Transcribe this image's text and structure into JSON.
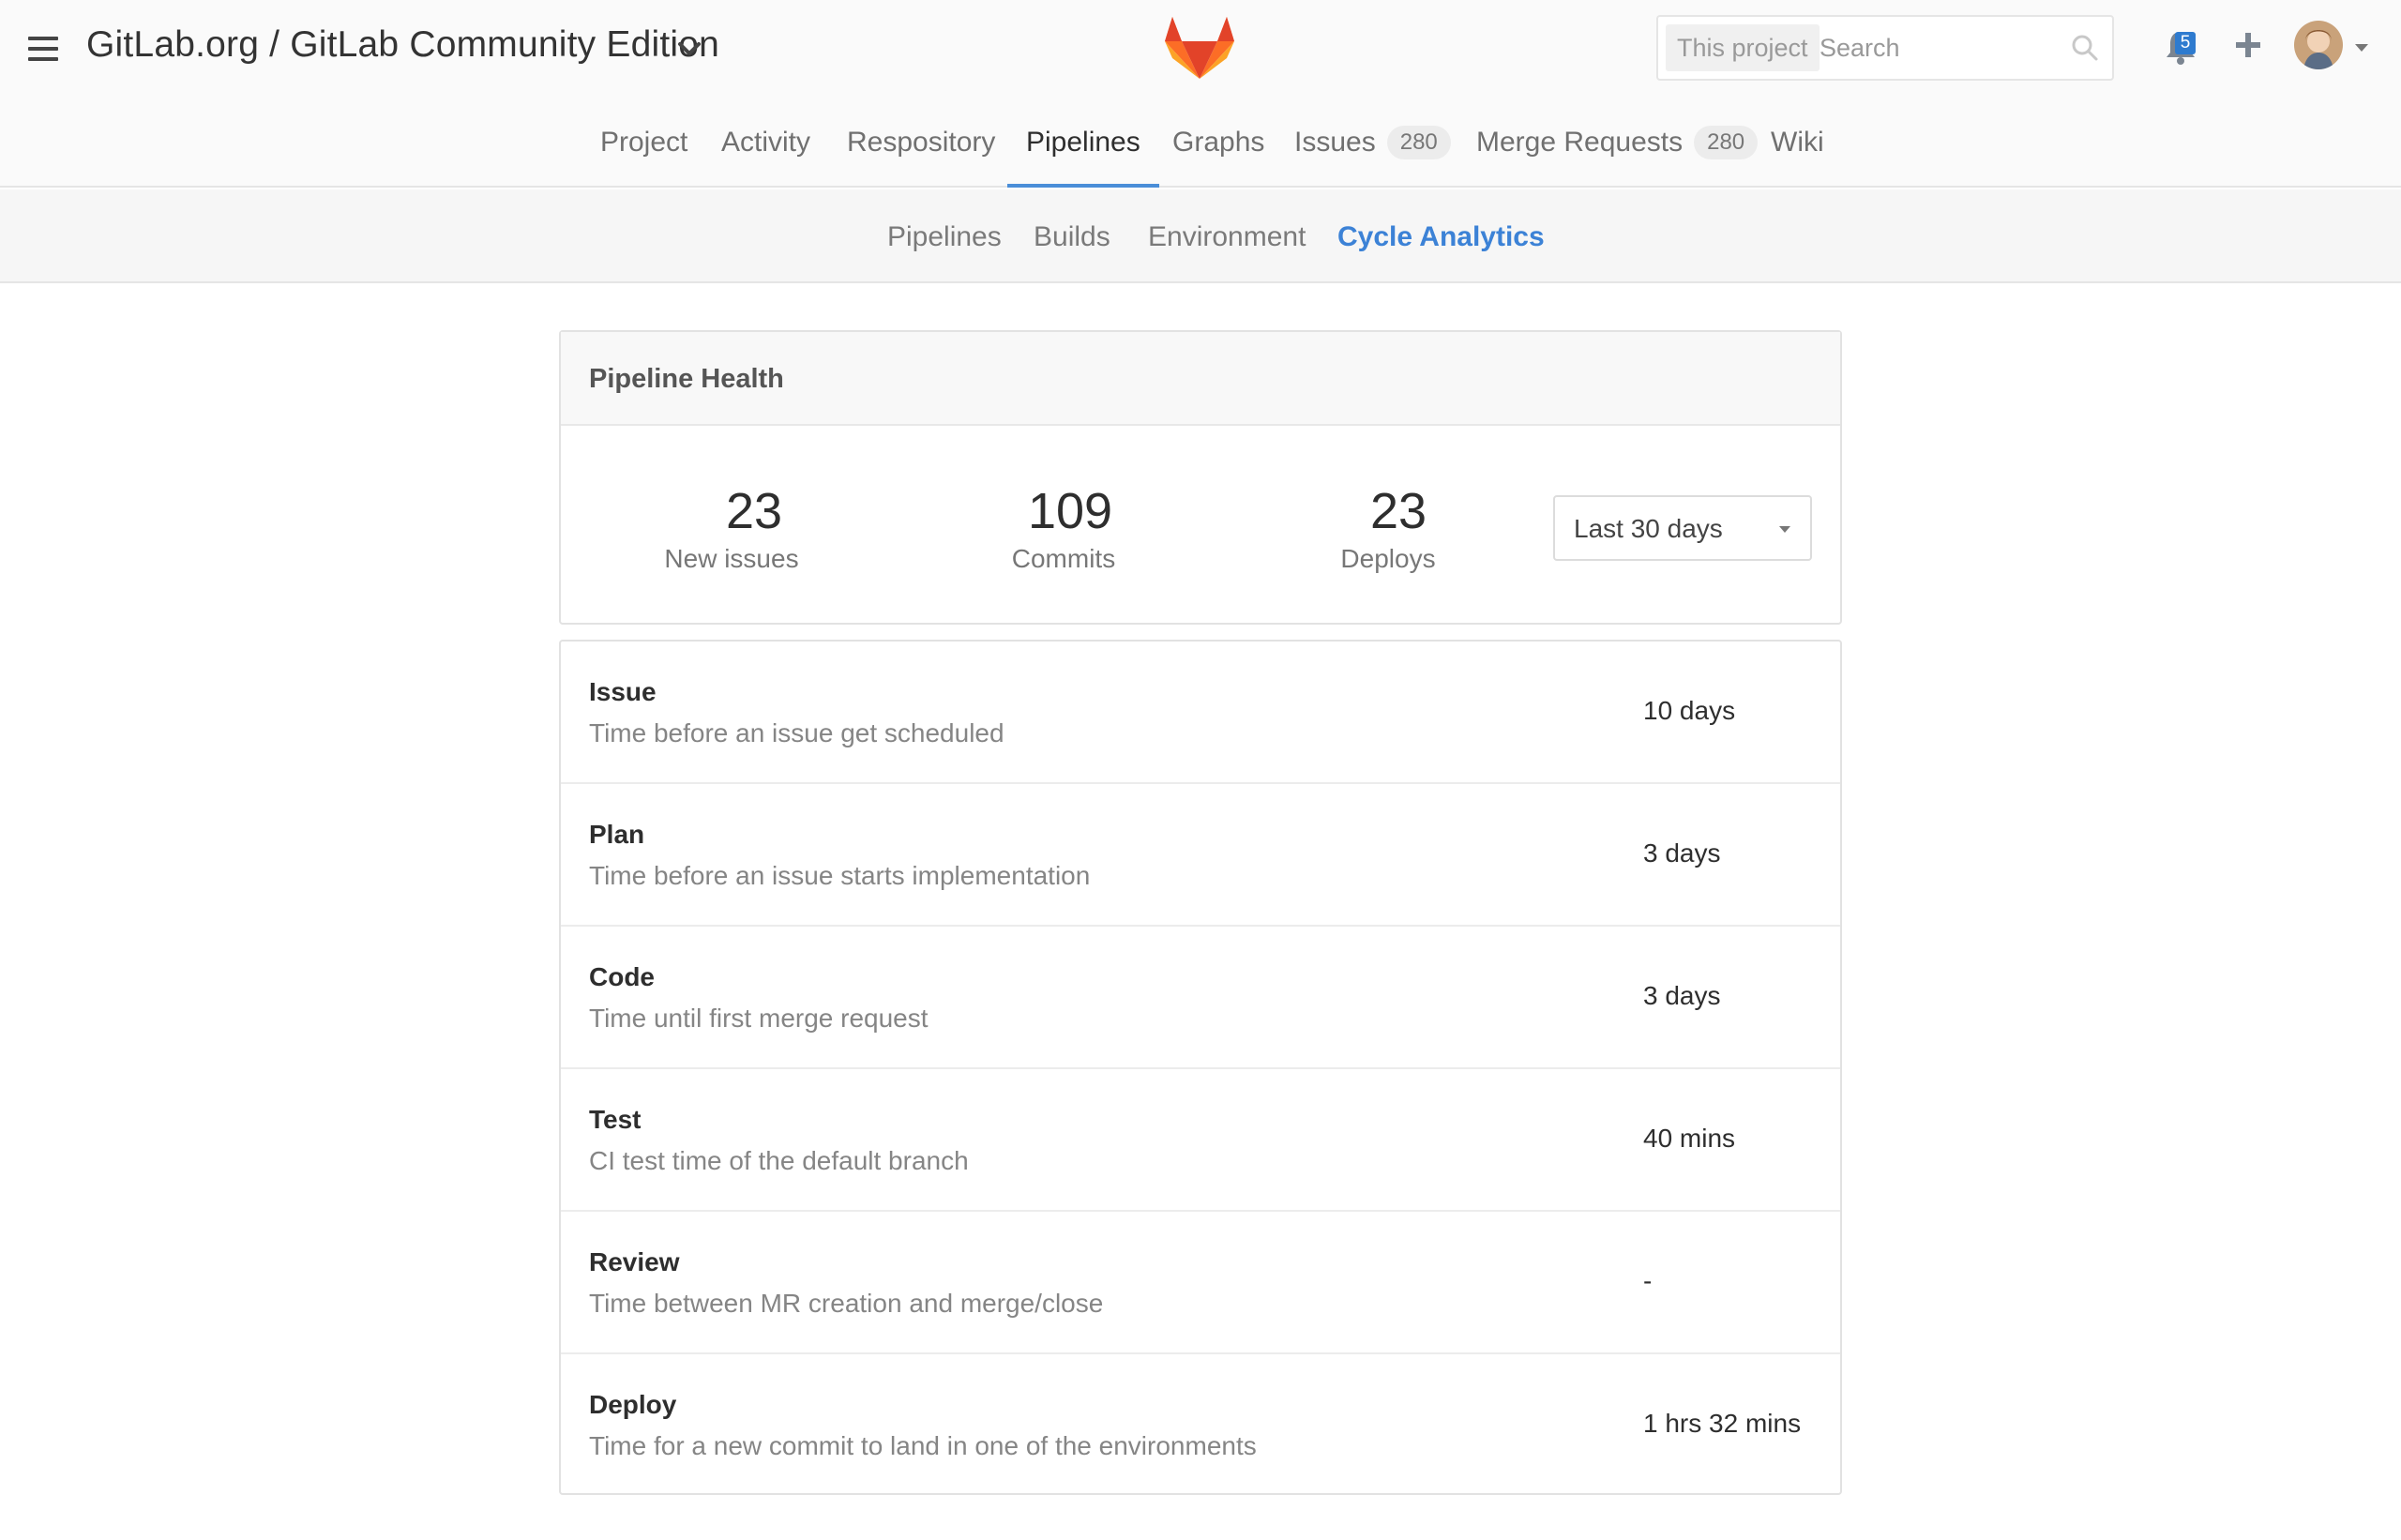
{
  "header": {
    "project_title": "GitLab.org / GitLab Community Edition",
    "search": {
      "scope_label": "This project",
      "placeholder": "Search"
    },
    "notifications_count": "5",
    "accent_color": "#4a8ed8"
  },
  "main_nav": {
    "items": [
      {
        "label": "Project"
      },
      {
        "label": "Activity"
      },
      {
        "label": "Respository"
      },
      {
        "label": "Pipelines",
        "active": true
      },
      {
        "label": "Graphs"
      },
      {
        "label": "Issues",
        "badge": "280"
      },
      {
        "label": "Merge Requests",
        "badge": "280"
      },
      {
        "label": "Wiki"
      }
    ]
  },
  "sub_nav": {
    "items": [
      {
        "label": "Pipelines"
      },
      {
        "label": "Builds"
      },
      {
        "label": "Environment"
      },
      {
        "label": "Cycle Analytics",
        "active": true
      }
    ]
  },
  "pipeline_health": {
    "title": "Pipeline Health",
    "stats": [
      {
        "value": "23",
        "label": "New issues"
      },
      {
        "value": "109",
        "label": "Commits"
      },
      {
        "value": "23",
        "label": "Deploys"
      }
    ],
    "period_select": {
      "value": "Last 30 days"
    }
  },
  "stages": [
    {
      "name": "Issue",
      "description": "Time before an issue get scheduled",
      "value": "10 days"
    },
    {
      "name": "Plan",
      "description": "Time before an issue starts implementation",
      "value": "3 days"
    },
    {
      "name": "Code",
      "description": "Time until first merge request",
      "value": "3 days"
    },
    {
      "name": "Test",
      "description": "CI test time of the default branch",
      "value": "40 mins"
    },
    {
      "name": "Review",
      "description": "Time between MR creation and merge/close",
      "value": "-"
    },
    {
      "name": "Deploy",
      "description": "Time for a new commit to land in one of the environments",
      "value": "1 hrs 32 mins"
    }
  ]
}
